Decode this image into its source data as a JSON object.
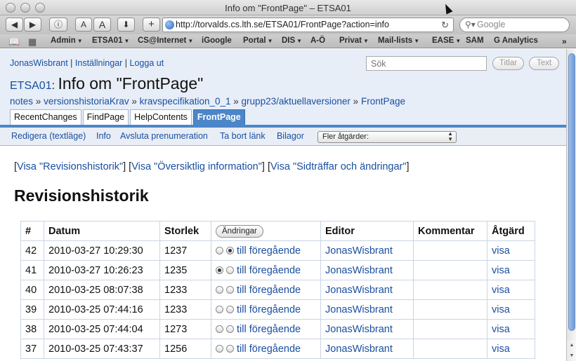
{
  "window": {
    "title": "Info om \"FrontPage\" – ETSA01"
  },
  "browser": {
    "url": "http://torvalds.cs.lth.se/ETSA01/FrontPage?action=info",
    "search_placeholder": "Google",
    "font_small_label": "A",
    "font_large_label": "A",
    "add_label": "+",
    "bookmarks": [
      "Admin",
      "ETSA01",
      "CS@Internet",
      "iGoogle",
      "Portal",
      "DIS",
      "A-Ö",
      "Privat",
      "Mail-lists",
      "EASE",
      "SAM",
      "G Analytics"
    ]
  },
  "wiki": {
    "user": {
      "name": "JonasWisbrant",
      "settings": "Inställningar",
      "logout": "Logga ut"
    },
    "search_placeholder": "Sök",
    "btn_titles": "Titlar",
    "btn_text": "Text",
    "site_name": "ETSA01",
    "site_sep": ":",
    "page_title": "Info om \"FrontPage\"",
    "breadcrumb": [
      "notes",
      "versionshistoriaKrav",
      "kravspecifikation_0_1",
      "grupp23/aktuellaversioner",
      "FrontPage"
    ],
    "tabs": [
      "RecentChanges",
      "FindPage",
      "HelpContents",
      "FrontPage"
    ],
    "actions": [
      "Redigera (textläge)",
      "Info",
      "Avsluta prenumeration",
      "Ta bort länk",
      "Bilagor"
    ],
    "more_actions": "Fler åtgärder:",
    "view_links": [
      "Visa \"Revisionshistorik\"",
      "Visa \"Översiktlig information\"",
      "Visa \"Sidträffar och ändringar\""
    ],
    "heading": "Revisionshistorik",
    "table": {
      "headers": [
        "#",
        "Datum",
        "Storlek",
        "Ändringar",
        "Editor",
        "Kommentar",
        "Åtgärd"
      ],
      "rows": [
        {
          "num": "42",
          "date": "2010-03-27 10:29:30",
          "size": "1237",
          "diff": "till föregående",
          "editor": "JonasWisbrant",
          "comment": "",
          "action": "visa"
        },
        {
          "num": "41",
          "date": "2010-03-27 10:26:23",
          "size": "1235",
          "diff": "till föregående",
          "editor": "JonasWisbrant",
          "comment": "",
          "action": "visa"
        },
        {
          "num": "40",
          "date": "2010-03-25 08:07:38",
          "size": "1233",
          "diff": "till föregående",
          "editor": "JonasWisbrant",
          "comment": "",
          "action": "visa"
        },
        {
          "num": "39",
          "date": "2010-03-25 07:44:16",
          "size": "1233",
          "diff": "till föregående",
          "editor": "JonasWisbrant",
          "comment": "",
          "action": "visa"
        },
        {
          "num": "38",
          "date": "2010-03-25 07:44:04",
          "size": "1273",
          "diff": "till föregående",
          "editor": "JonasWisbrant",
          "comment": "",
          "action": "visa"
        },
        {
          "num": "37",
          "date": "2010-03-25 07:43:37",
          "size": "1256",
          "diff": "till föregående",
          "editor": "JonasWisbrant",
          "comment": "",
          "action": "visa"
        }
      ]
    }
  }
}
